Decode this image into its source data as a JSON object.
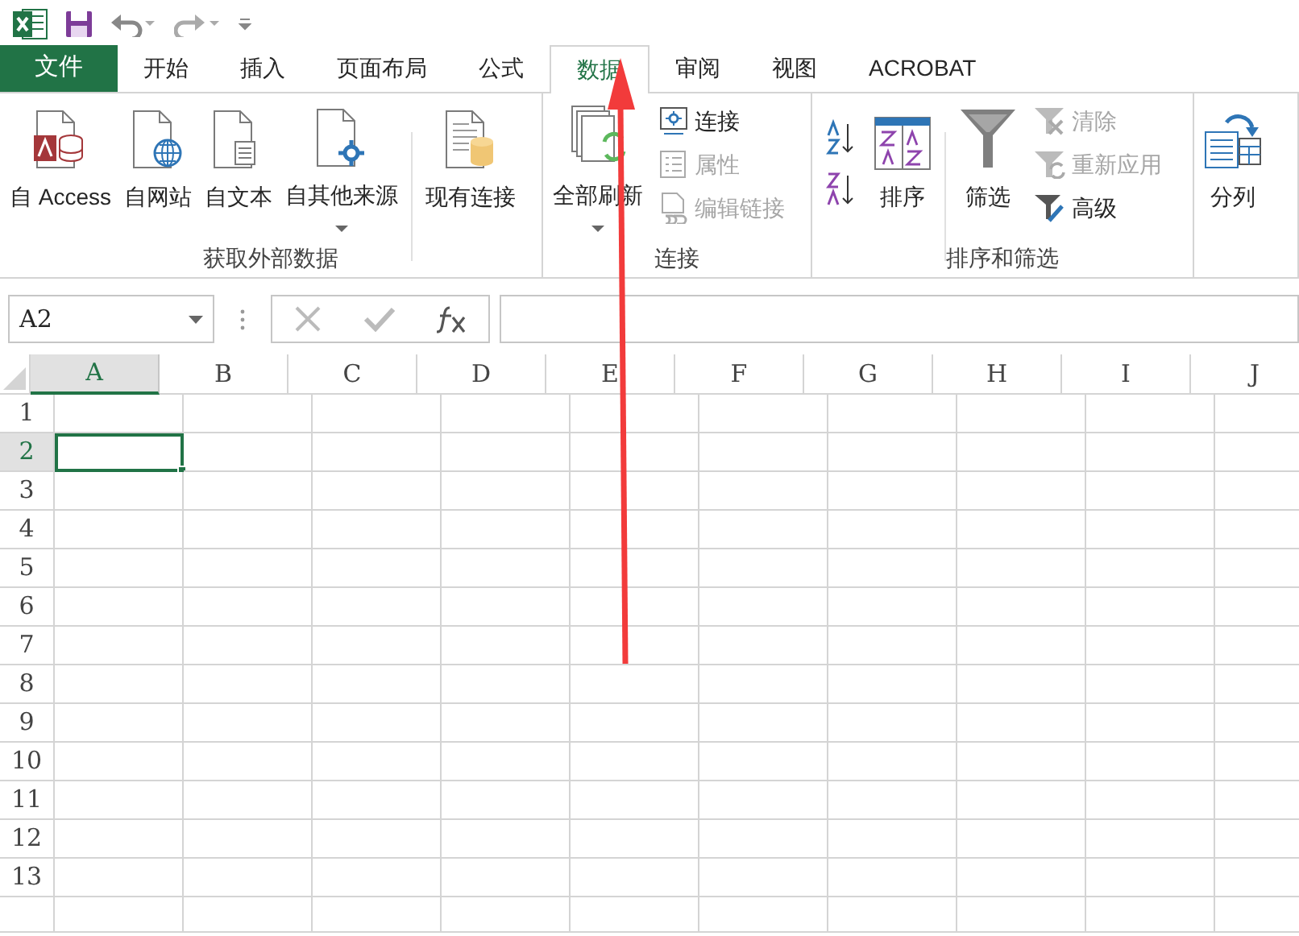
{
  "tabs": [
    {
      "label": "文件",
      "kind": "file",
      "selected": false
    },
    {
      "label": "开始",
      "kind": "tab",
      "selected": false
    },
    {
      "label": "插入",
      "kind": "tab",
      "selected": false
    },
    {
      "label": "页面布局",
      "kind": "tab",
      "selected": false
    },
    {
      "label": "公式",
      "kind": "tab",
      "selected": false
    },
    {
      "label": "数据",
      "kind": "tab",
      "selected": true
    },
    {
      "label": "审阅",
      "kind": "tab",
      "selected": false
    },
    {
      "label": "视图",
      "kind": "tab",
      "selected": false
    },
    {
      "label": "ACROBAT",
      "kind": "tab",
      "selected": false
    }
  ],
  "ribbon": {
    "groups": [
      {
        "label": "获取外部数据",
        "buttons": [
          {
            "label": "自 Access",
            "dropdown": false
          },
          {
            "label": "自网站",
            "dropdown": false
          },
          {
            "label": "自文本",
            "dropdown": false
          },
          {
            "label": "自其他来源",
            "dropdown": true
          },
          {
            "label": "现有连接",
            "dropdown": false
          }
        ]
      },
      {
        "label": "连接",
        "buttons": [
          {
            "label": "全部刷新",
            "dropdown": true
          }
        ],
        "commands": [
          {
            "label": "连接",
            "disabled": false
          },
          {
            "label": "属性",
            "disabled": true
          },
          {
            "label": "编辑链接",
            "disabled": true
          }
        ]
      },
      {
        "label": "排序和筛选",
        "buttons": [
          {
            "label": "排序",
            "dropdown": false
          },
          {
            "label": "筛选",
            "dropdown": false
          }
        ],
        "commands": [
          {
            "label": "清除",
            "disabled": true
          },
          {
            "label": "重新应用",
            "disabled": true
          },
          {
            "label": "高级",
            "disabled": false
          }
        ]
      },
      {
        "buttons": [
          {
            "label": "分列",
            "dropdown": false
          }
        ]
      }
    ]
  },
  "formula_bar": {
    "name_box": "A2"
  },
  "sheet": {
    "columns": [
      {
        "label": "A",
        "selected": true
      },
      {
        "label": "B",
        "selected": false
      },
      {
        "label": "C",
        "selected": false
      },
      {
        "label": "D",
        "selected": false
      },
      {
        "label": "E",
        "selected": false
      },
      {
        "label": "F",
        "selected": false
      },
      {
        "label": "G",
        "selected": false
      },
      {
        "label": "H",
        "selected": false
      },
      {
        "label": "I",
        "selected": false
      },
      {
        "label": "J",
        "selected": false
      }
    ],
    "rows": [
      {
        "label": "1",
        "selected": false
      },
      {
        "label": "2",
        "selected": true
      },
      {
        "label": "3",
        "selected": false
      },
      {
        "label": "4",
        "selected": false
      },
      {
        "label": "5",
        "selected": false
      },
      {
        "label": "6",
        "selected": false
      },
      {
        "label": "7",
        "selected": false
      },
      {
        "label": "8",
        "selected": false
      },
      {
        "label": "9",
        "selected": false
      },
      {
        "label": "10",
        "selected": false
      },
      {
        "label": "11",
        "selected": false
      },
      {
        "label": "12",
        "selected": false
      },
      {
        "label": "13",
        "selected": false
      }
    ]
  }
}
